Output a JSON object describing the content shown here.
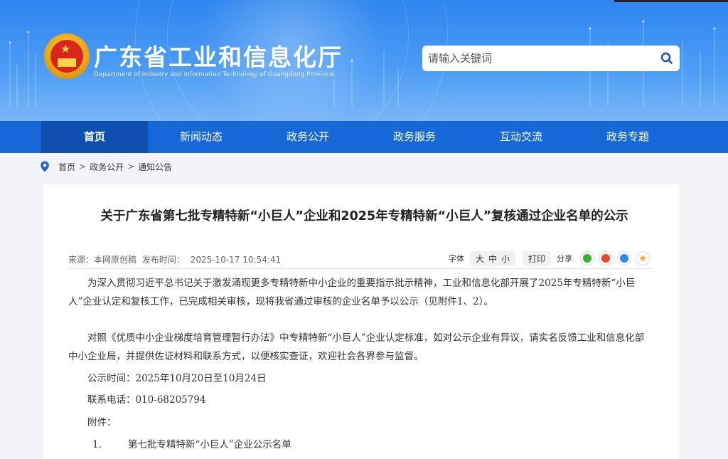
{
  "header": {
    "title": "广东省工业和信息化厅",
    "subtitle": "Department of Industry and Information Technology of Guangdong Province",
    "search_placeholder": "请输入关键词"
  },
  "nav": {
    "items": [
      {
        "label": "首页",
        "active": true
      },
      {
        "label": "新闻动态"
      },
      {
        "label": "政务公开"
      },
      {
        "label": "政务服务"
      },
      {
        "label": "互动交流"
      },
      {
        "label": "政务专题"
      }
    ]
  },
  "breadcrumb": {
    "items": [
      "首页",
      "政务公开",
      "通知公告"
    ],
    "separator": ">"
  },
  "article": {
    "title": "关于广东省第七批专精特新“小巨人”企业和2025年专精特新“小巨人”复核通过企业名单的公示",
    "source_label": "来源：本网原创稿",
    "publish_label": "发布时间：",
    "publish_time": "2025-10-17 10:54:41",
    "tools": {
      "font_label": "字体",
      "sizes": [
        "大",
        "中",
        "小"
      ],
      "print_label": "打印",
      "share_label": "分享"
    },
    "paragraphs": [
      "为深入贯彻习近平总书记关于激发涌现更多专精特新中小企业的重要指示批示精神，工业和信息化部开展了2025年专精特新“小巨人”企业认定和复核工作，已完成相关审核，现将我省通过审核的企业名单予以公示（见附件1、2）。",
      "对照《优质中小企业梯度培育管理暂行办法》中专精特新“小巨人”企业认定标准，如对公示企业有异议，请实名反馈工业和信息化部中小企业局，并提供佐证材料和联系方式，以便核实查证，欢迎社会各界参与监督。",
      "公示时间：2025年10月20日至10月24日",
      "联系电话：010-68205794",
      "附件："
    ],
    "attachment": {
      "num": "1.",
      "label": "第七批专精特新“小巨人”企业公示名单"
    }
  },
  "colors": {
    "header_blue": "#2f86ef",
    "nav_blue": "#1668d8",
    "nav_active": "#0e4fb0"
  },
  "share_icons": [
    "wechat-icon",
    "weibo-icon",
    "qq-icon",
    "favorite-icon"
  ]
}
